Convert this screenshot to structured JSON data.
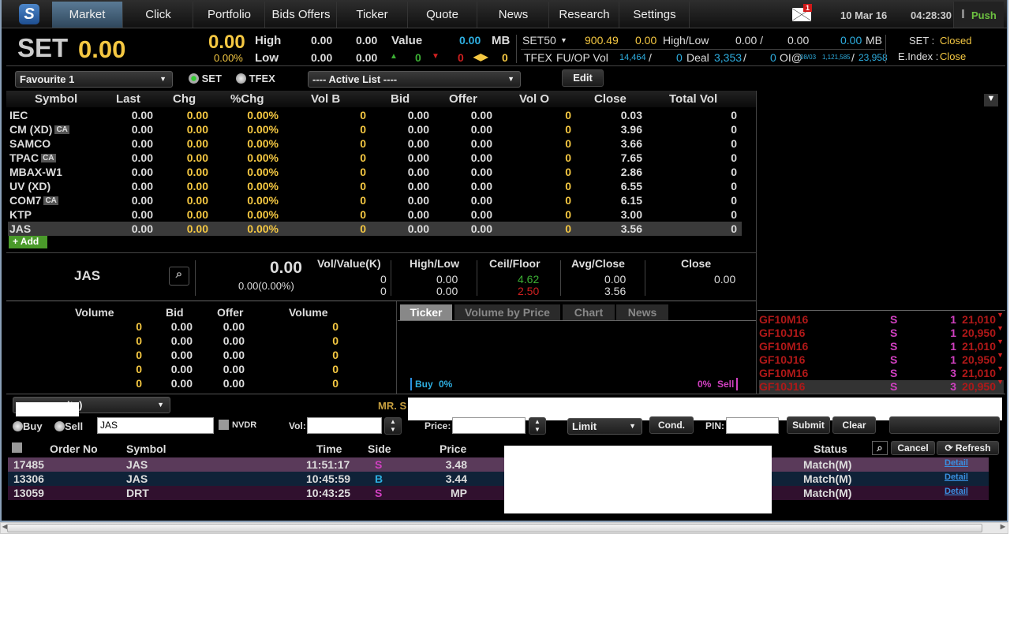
{
  "nav": {
    "tabs": [
      "Market",
      "Click",
      "Portfolio",
      "Bids Offers",
      "Ticker",
      "Quote",
      "News",
      "Research",
      "Settings"
    ],
    "active": "Market",
    "mail_badge": "1",
    "date": "10 Mar 16",
    "time": "04:28:30",
    "push": "Push"
  },
  "index": {
    "name": "SET",
    "value": "0.00",
    "chg": "0.00",
    "pct": "0.00%",
    "high_label": "High",
    "low_label": "Low",
    "high1": "0.00",
    "high2": "0.00",
    "low1": "0.00",
    "low2": "0.00",
    "value_label": "Value",
    "mb": "MB",
    "up": "0",
    "down": "0",
    "unch": "0"
  },
  "set50": {
    "label": "SET50",
    "value": "900.49",
    "chg": "0.00",
    "hl_label": "High/Low",
    "high": "0.00 /",
    "low": "0.00",
    "mb_value": "0.00",
    "mb": "MB"
  },
  "tfex": {
    "label": "TFEX",
    "fuop_label": "FU/OP Vol",
    "fu": "14,464",
    "slash1": "/",
    "op": "0",
    "deal_label": "Deal",
    "deal1": "3,353",
    "slash2": "/",
    "deal2": "0",
    "oi_label": "OI@",
    "oi_date": "08/03",
    "oi1": "1,121,585",
    "slash3": "/",
    "oi2": "23,958"
  },
  "status": {
    "set_label": "SET :",
    "set_value": "Closed",
    "eindex_label": "E.Index :",
    "eindex_value": "Close"
  },
  "toolbar": {
    "favourite": "Favourite 1",
    "radio_set": "SET",
    "radio_tfex": "TFEX",
    "active_list": "---- Active List ----",
    "edit": "Edit"
  },
  "watchlist": {
    "headers": [
      "Symbol",
      "Last",
      "Chg",
      "%Chg",
      "Vol B",
      "Bid",
      "Offer",
      "Vol O",
      "Close",
      "Total Vol"
    ],
    "rows": [
      {
        "symbol": "IEC",
        "ca": "",
        "last": "0.00",
        "chg": "0.00",
        "pct": "0.00%",
        "volb": "0",
        "bid": "0.00",
        "offer": "0.00",
        "volo": "0",
        "close": "0.03",
        "total": "0"
      },
      {
        "symbol": "CM (XD)",
        "ca": "CA",
        "last": "0.00",
        "chg": "0.00",
        "pct": "0.00%",
        "volb": "0",
        "bid": "0.00",
        "offer": "0.00",
        "volo": "0",
        "close": "3.96",
        "total": "0"
      },
      {
        "symbol": "SAMCO",
        "ca": "",
        "last": "0.00",
        "chg": "0.00",
        "pct": "0.00%",
        "volb": "0",
        "bid": "0.00",
        "offer": "0.00",
        "volo": "0",
        "close": "3.66",
        "total": "0"
      },
      {
        "symbol": "TPAC",
        "ca": "CA",
        "last": "0.00",
        "chg": "0.00",
        "pct": "0.00%",
        "volb": "0",
        "bid": "0.00",
        "offer": "0.00",
        "volo": "0",
        "close": "7.65",
        "total": "0"
      },
      {
        "symbol": "MBAX-W1",
        "ca": "",
        "last": "0.00",
        "chg": "0.00",
        "pct": "0.00%",
        "volb": "0",
        "bid": "0.00",
        "offer": "0.00",
        "volo": "0",
        "close": "2.86",
        "total": "0"
      },
      {
        "symbol": "UV (XD)",
        "ca": "",
        "last": "0.00",
        "chg": "0.00",
        "pct": "0.00%",
        "volb": "0",
        "bid": "0.00",
        "offer": "0.00",
        "volo": "0",
        "close": "6.55",
        "total": "0"
      },
      {
        "symbol": "COM7",
        "ca": "CA",
        "last": "0.00",
        "chg": "0.00",
        "pct": "0.00%",
        "volb": "0",
        "bid": "0.00",
        "offer": "0.00",
        "volo": "0",
        "close": "6.15",
        "total": "0"
      },
      {
        "symbol": "KTP",
        "ca": "",
        "last": "0.00",
        "chg": "0.00",
        "pct": "0.00%",
        "volb": "0",
        "bid": "0.00",
        "offer": "0.00",
        "volo": "0",
        "close": "3.00",
        "total": "0"
      },
      {
        "symbol": "JAS",
        "ca": "",
        "last": "0.00",
        "chg": "0.00",
        "pct": "0.00%",
        "volb": "0",
        "bid": "0.00",
        "offer": "0.00",
        "volo": "0",
        "close": "3.56",
        "total": "0"
      }
    ],
    "add": "Add"
  },
  "quote": {
    "symbol": "JAS",
    "last": "0.00",
    "chg": "0.00(0.00%)",
    "vv_label": "Vol/Value(K)",
    "vol": "0",
    "value": "0",
    "hl_label": "High/Low",
    "high": "0.00",
    "low": "0.00",
    "cf_label": "Ceil/Floor",
    "ceil": "4.62",
    "floor": "2.50",
    "ac_label": "Avg/Close",
    "avg": "0.00",
    "close": "3.56",
    "close_label": "Close",
    "close_value": "0.00"
  },
  "bidoffer": {
    "headers": [
      "Volume",
      "Bid",
      "Offer",
      "Volume"
    ],
    "rows": [
      [
        "0",
        "0.00",
        "0.00",
        "0"
      ],
      [
        "0",
        "0.00",
        "0.00",
        "0"
      ],
      [
        "0",
        "0.00",
        "0.00",
        "0"
      ],
      [
        "0",
        "0.00",
        "0.00",
        "0"
      ],
      [
        "0",
        "0.00",
        "0.00",
        "0"
      ]
    ]
  },
  "ticker_tabs": [
    "Ticker",
    "Volume by Price",
    "Chart",
    "News"
  ],
  "ticker": {
    "buy": "Buy",
    "buy_pct": "0%",
    "sell": "Sell",
    "sell_pct": "0%"
  },
  "tfex_ticker": [
    [
      "GF10M16",
      "S",
      "1",
      "21,010"
    ],
    [
      "GF10J16",
      "S",
      "1",
      "20,950"
    ],
    [
      "GF10M16",
      "S",
      "1",
      "21,010"
    ],
    [
      "GF10J16",
      "S",
      "1",
      "20,950"
    ],
    [
      "GF10M16",
      "S",
      "3",
      "21,010"
    ],
    [
      "GF10J16",
      "S",
      "3",
      "20,950"
    ]
  ],
  "order": {
    "account": "uity)",
    "name": "MR. S",
    "buy": "Buy",
    "sell": "Sell",
    "symbol": "JAS",
    "nvdr": "NVDR",
    "vol_label": "Vol:",
    "price_label": "Price:",
    "type": "Limit",
    "cond": "Cond.",
    "pin_label": "PIN:",
    "submit": "Submit",
    "clear": "Clear"
  },
  "orders": {
    "headers": [
      "Order No",
      "Symbol",
      "Time",
      "Side",
      "Price",
      "Status"
    ],
    "cancel": "Cancel",
    "refresh": "Refresh",
    "rows": [
      {
        "no": "17485",
        "symbol": "JAS",
        "time": "11:51:17",
        "side": "S",
        "price": "3.48",
        "status": "Match(M)",
        "detail": "Detail"
      },
      {
        "no": "13306",
        "symbol": "JAS",
        "time": "10:45:59",
        "side": "B",
        "price": "3.44",
        "status": "Match(M)",
        "detail": "Detail"
      },
      {
        "no": "13059",
        "symbol": "DRT",
        "time": "10:43:25",
        "side": "S",
        "price": "MP",
        "status": "Match(M)",
        "detail": "Detail"
      }
    ]
  }
}
